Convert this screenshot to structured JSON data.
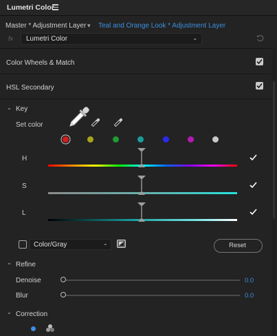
{
  "panel": {
    "title": "Lumetri Color"
  },
  "breadcrumb": {
    "master": "Master * Adjustment Layer",
    "clip": "Teal and Orange Look * Adjustment Layer"
  },
  "effect": {
    "fx_label": "fx",
    "selected": "Lumetri Color"
  },
  "sections": {
    "color_wheels": {
      "label": "Color Wheels & Match",
      "checked": true
    },
    "hsl_secondary": {
      "label": "HSL Secondary",
      "checked": true
    }
  },
  "key": {
    "label": "Key",
    "set_color_label": "Set color",
    "swatches": [
      "#d12020",
      "#a7a41a",
      "#1e9c33",
      "#1b9c9c",
      "#2a2af0",
      "#b41ab4",
      "#c9c9c9"
    ],
    "selected_swatch_index": 0,
    "h_label": "H",
    "s_label": "S",
    "l_label": "L",
    "h_checked": true,
    "s_checked": true,
    "l_checked": true
  },
  "display": {
    "mode_selected": "Color/Gray",
    "show_mask_checked": false,
    "reset_label": "Reset"
  },
  "refine": {
    "label": "Refine",
    "denoise_label": "Denoise",
    "denoise_value": "0.0",
    "blur_label": "Blur",
    "blur_value": "0.0"
  },
  "correction": {
    "label": "Correction"
  },
  "colors": {
    "accent": "#3d8fe0",
    "panel_bg": "#232323"
  }
}
